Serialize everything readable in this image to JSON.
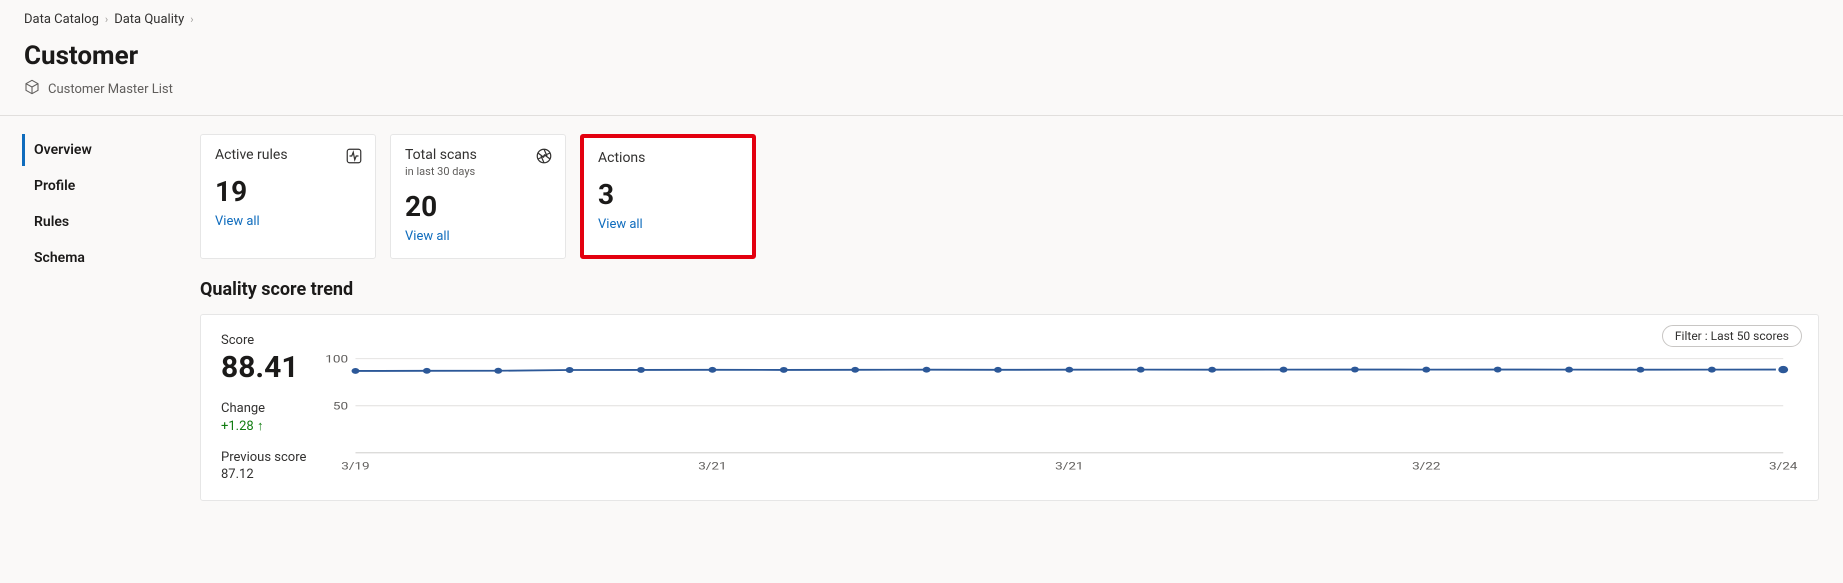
{
  "breadcrumb": {
    "items": [
      {
        "label": "Data Catalog"
      },
      {
        "label": "Data Quality"
      }
    ]
  },
  "header": {
    "title": "Customer",
    "subtitle": "Customer Master List"
  },
  "sidebar": {
    "items": [
      {
        "label": "Overview",
        "active": true
      },
      {
        "label": "Profile",
        "active": false
      },
      {
        "label": "Rules",
        "active": false
      },
      {
        "label": "Schema",
        "active": false
      }
    ]
  },
  "cards": [
    {
      "title": "Active rules",
      "subtitle": "",
      "value": "19",
      "link": "View all",
      "icon": "pulse",
      "highlight": false
    },
    {
      "title": "Total scans",
      "subtitle": "in last 30 days",
      "value": "20",
      "link": "View all",
      "icon": "aperture",
      "highlight": false
    },
    {
      "title": "Actions",
      "subtitle": "",
      "value": "3",
      "link": "View all",
      "icon": "",
      "highlight": true
    }
  ],
  "trend": {
    "section_title": "Quality score trend",
    "score_label": "Score",
    "score_value": "88.41",
    "change_label": "Change",
    "change_value": "+1.28 ↑",
    "previous_label": "Previous score",
    "previous_value": "87.12",
    "filter_label": "Filter : Last 50 scores"
  },
  "chart_data": {
    "type": "line",
    "ylim": [
      0,
      100
    ],
    "yticks": [
      100,
      50
    ],
    "x_labels": [
      "3/19",
      "3/21",
      "3/21",
      "3/22",
      "3/24"
    ],
    "values": [
      87.0,
      87.1,
      87.2,
      88.0,
      88.1,
      88.2,
      88.1,
      88.2,
      88.3,
      88.2,
      88.3,
      88.4,
      88.3,
      88.4,
      88.5,
      88.4,
      88.5,
      88.4,
      88.3,
      88.4,
      88.41
    ]
  }
}
